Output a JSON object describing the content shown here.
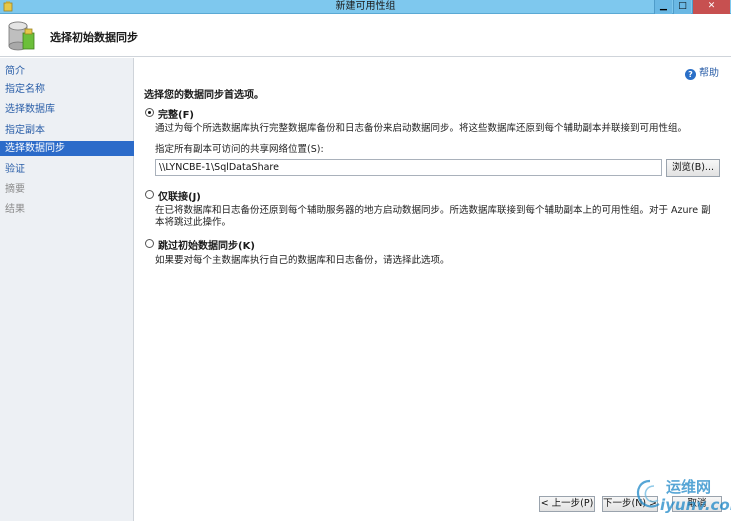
{
  "window": {
    "title": "新建可用性组",
    "min_glyph": "▁",
    "max_glyph": "□",
    "close_glyph": "✕"
  },
  "header": {
    "heading": "选择初始数据同步"
  },
  "nav": {
    "items": [
      {
        "label": "简介",
        "state": "normal"
      },
      {
        "label": "指定名称",
        "state": "normal"
      },
      {
        "label": "选择数据库",
        "state": "normal"
      },
      {
        "label": "指定副本",
        "state": "normal"
      },
      {
        "label": "选择数据同步",
        "state": "selected"
      },
      {
        "label": "验证",
        "state": "normal"
      },
      {
        "label": "摘要",
        "state": "disabled"
      },
      {
        "label": "结果",
        "state": "disabled"
      }
    ]
  },
  "content": {
    "help_label": "帮助",
    "section_title": "选择您的数据同步首选项。",
    "options": [
      {
        "label": "完整(F)",
        "checked": true,
        "description": "通过为每个所选数据库执行完整数据库备份和日志备份来启动数据同步。将这些数据库还原到每个辅助副本并联接到可用性组。"
      },
      {
        "label": "仅联接(J)",
        "checked": false,
        "description": "在已将数据库和日志备份还原到每个辅助服务器的地方启动数据同步。所选数据库联接到每个辅助副本上的可用性组。对于 Azure 副本将跳过此操作。"
      },
      {
        "label": "跳过初始数据同步(K)",
        "checked": false,
        "description": "如果要对每个主数据库执行自己的数据库和日志备份，请选择此选项。"
      }
    ],
    "share_location_label": "指定所有副本可访问的共享网络位置(S):",
    "share_location_value": "\\\\LYNCBE-1\\SqlDataShare",
    "browse_label": "浏览(B)..."
  },
  "footer": {
    "prev_label": "< 上一步(P)",
    "next_label": "下一步(N) >",
    "cancel_label": "取消"
  },
  "watermark": {
    "line1": "运维网",
    "line2": "iyunv.com"
  }
}
